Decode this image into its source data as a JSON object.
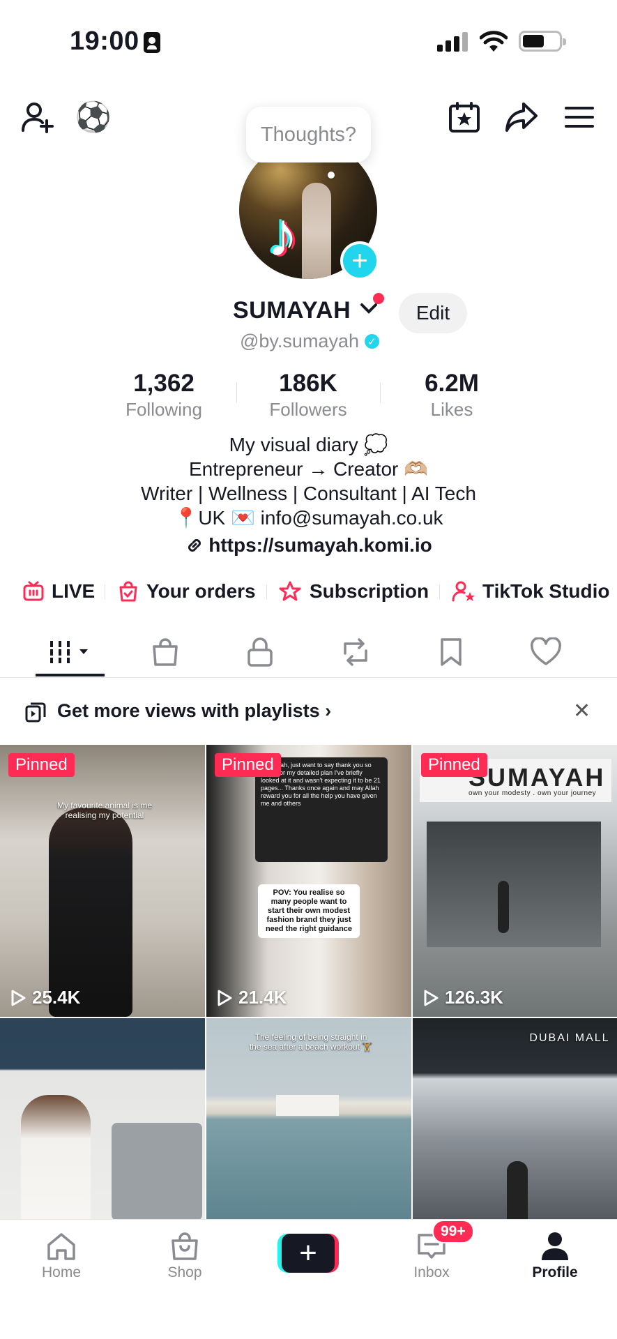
{
  "status_bar": {
    "time": "19:00"
  },
  "tooltip": "Thoughts?",
  "profile": {
    "name": "SUMAYAH",
    "handle": "@by.sumayah",
    "edit_label": "Edit"
  },
  "stats": [
    {
      "value": "1,362",
      "label": "Following"
    },
    {
      "value": "186K",
      "label": "Followers"
    },
    {
      "value": "6.2M",
      "label": "Likes"
    }
  ],
  "bio": {
    "lines": [
      "My visual diary 💭",
      "Entrepreneur → Creator 🫶🏼",
      "Writer | Wellness | Consultant | AI Tech",
      "📍UK 💌 info@sumayah.co.uk"
    ],
    "link": "https://sumayah.komi.io"
  },
  "shortcuts": [
    {
      "label": "LIVE",
      "icon": "tv-icon"
    },
    {
      "label": "Your orders",
      "icon": "orders-bag-icon"
    },
    {
      "label": "Subscription",
      "icon": "subscription-star-icon"
    },
    {
      "label": "TikTok Studio",
      "icon": "studio-person-icon"
    }
  ],
  "tabs": [
    "videos-grid-icon",
    "shop-bag-icon",
    "lock-icon",
    "repost-icon",
    "bookmark-icon",
    "heart-icon"
  ],
  "playlist_banner": {
    "text": "Get more views with playlists"
  },
  "videos": [
    {
      "pinned": "Pinned",
      "views": "25.4K",
      "caption": "My favourite animal is me realising my potential"
    },
    {
      "pinned": "Pinned",
      "views": "21.4K",
      "caption": "POV: You realise so many people want to start their own modest fashion brand they just need the right guidance"
    },
    {
      "pinned": "Pinned",
      "views": "126.3K",
      "caption": "SUMAYAH",
      "subcaption": "own your modesty . own your journey"
    },
    {
      "pinned": "",
      "views": "",
      "caption": ""
    },
    {
      "pinned": "",
      "views": "",
      "caption": "The feeling of being straight in the sea after a beach workout 🏋️"
    },
    {
      "pinned": "",
      "views": "",
      "caption": "DUBAI MALL"
    }
  ],
  "bottom_nav": {
    "items": [
      "Home",
      "Shop",
      "",
      "Inbox",
      "Profile"
    ],
    "inbox_badge": "99+"
  },
  "colors": {
    "accent": "#fe2c55",
    "cyan": "#20d5ec",
    "text": "#161823",
    "muted": "#8a8b91"
  }
}
